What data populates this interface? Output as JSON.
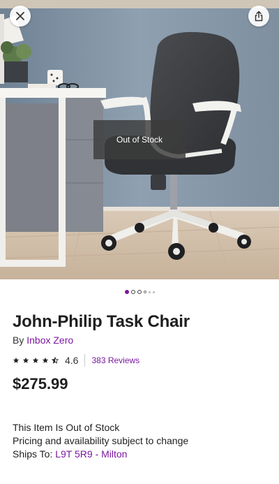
{
  "hero": {
    "overlay_text": "Out of Stock",
    "close_icon": "close-icon",
    "share_icon": "share-icon"
  },
  "carousel": {
    "total": 6,
    "active_index": 0
  },
  "product": {
    "title": "John-Philip Task Chair",
    "by_prefix": "By ",
    "brand": "Inbox Zero",
    "rating": "4.6",
    "rating_fraction": 0.92,
    "reviews": "383 Reviews",
    "price": "$275.99"
  },
  "availability": {
    "status": "This Item Is Out of Stock",
    "note": "Pricing and availability subject to change",
    "ships_label": "Ships To: ",
    "ships_location": "L9T 5R9 - Milton"
  },
  "colors": {
    "accent": "#7b189f",
    "text": "#1f1f1f"
  }
}
